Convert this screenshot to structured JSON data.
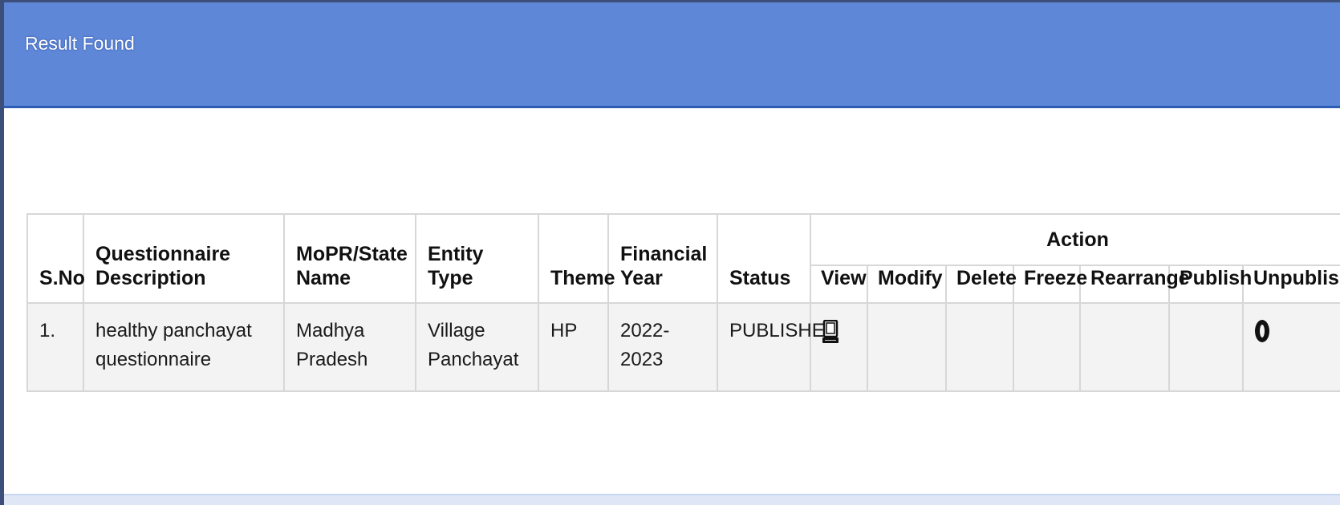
{
  "panel": {
    "title": "Result Found"
  },
  "table": {
    "headers": {
      "sno": "S.No",
      "description": "Questionnaire Description",
      "state": "MoPR/State Name",
      "entity_type": "Entity Type",
      "theme": "Theme",
      "financial_year": "Financial Year",
      "status": "Status",
      "action": "Action",
      "action_columns": [
        "View",
        "Modify",
        "Delete",
        "Freeze",
        "Rearrange",
        "Publish",
        "Unpublish"
      ]
    },
    "rows": [
      {
        "sno": "1.",
        "description": "healthy panchayat questionnaire",
        "state": "Madhya Pradesh",
        "entity_type": "Village Panchayat",
        "theme": "HP",
        "financial_year": "2022-2023",
        "status": "PUBLISHED",
        "actions": {
          "view": "computer-icon",
          "unpublish": "circle-icon"
        }
      }
    ]
  }
}
